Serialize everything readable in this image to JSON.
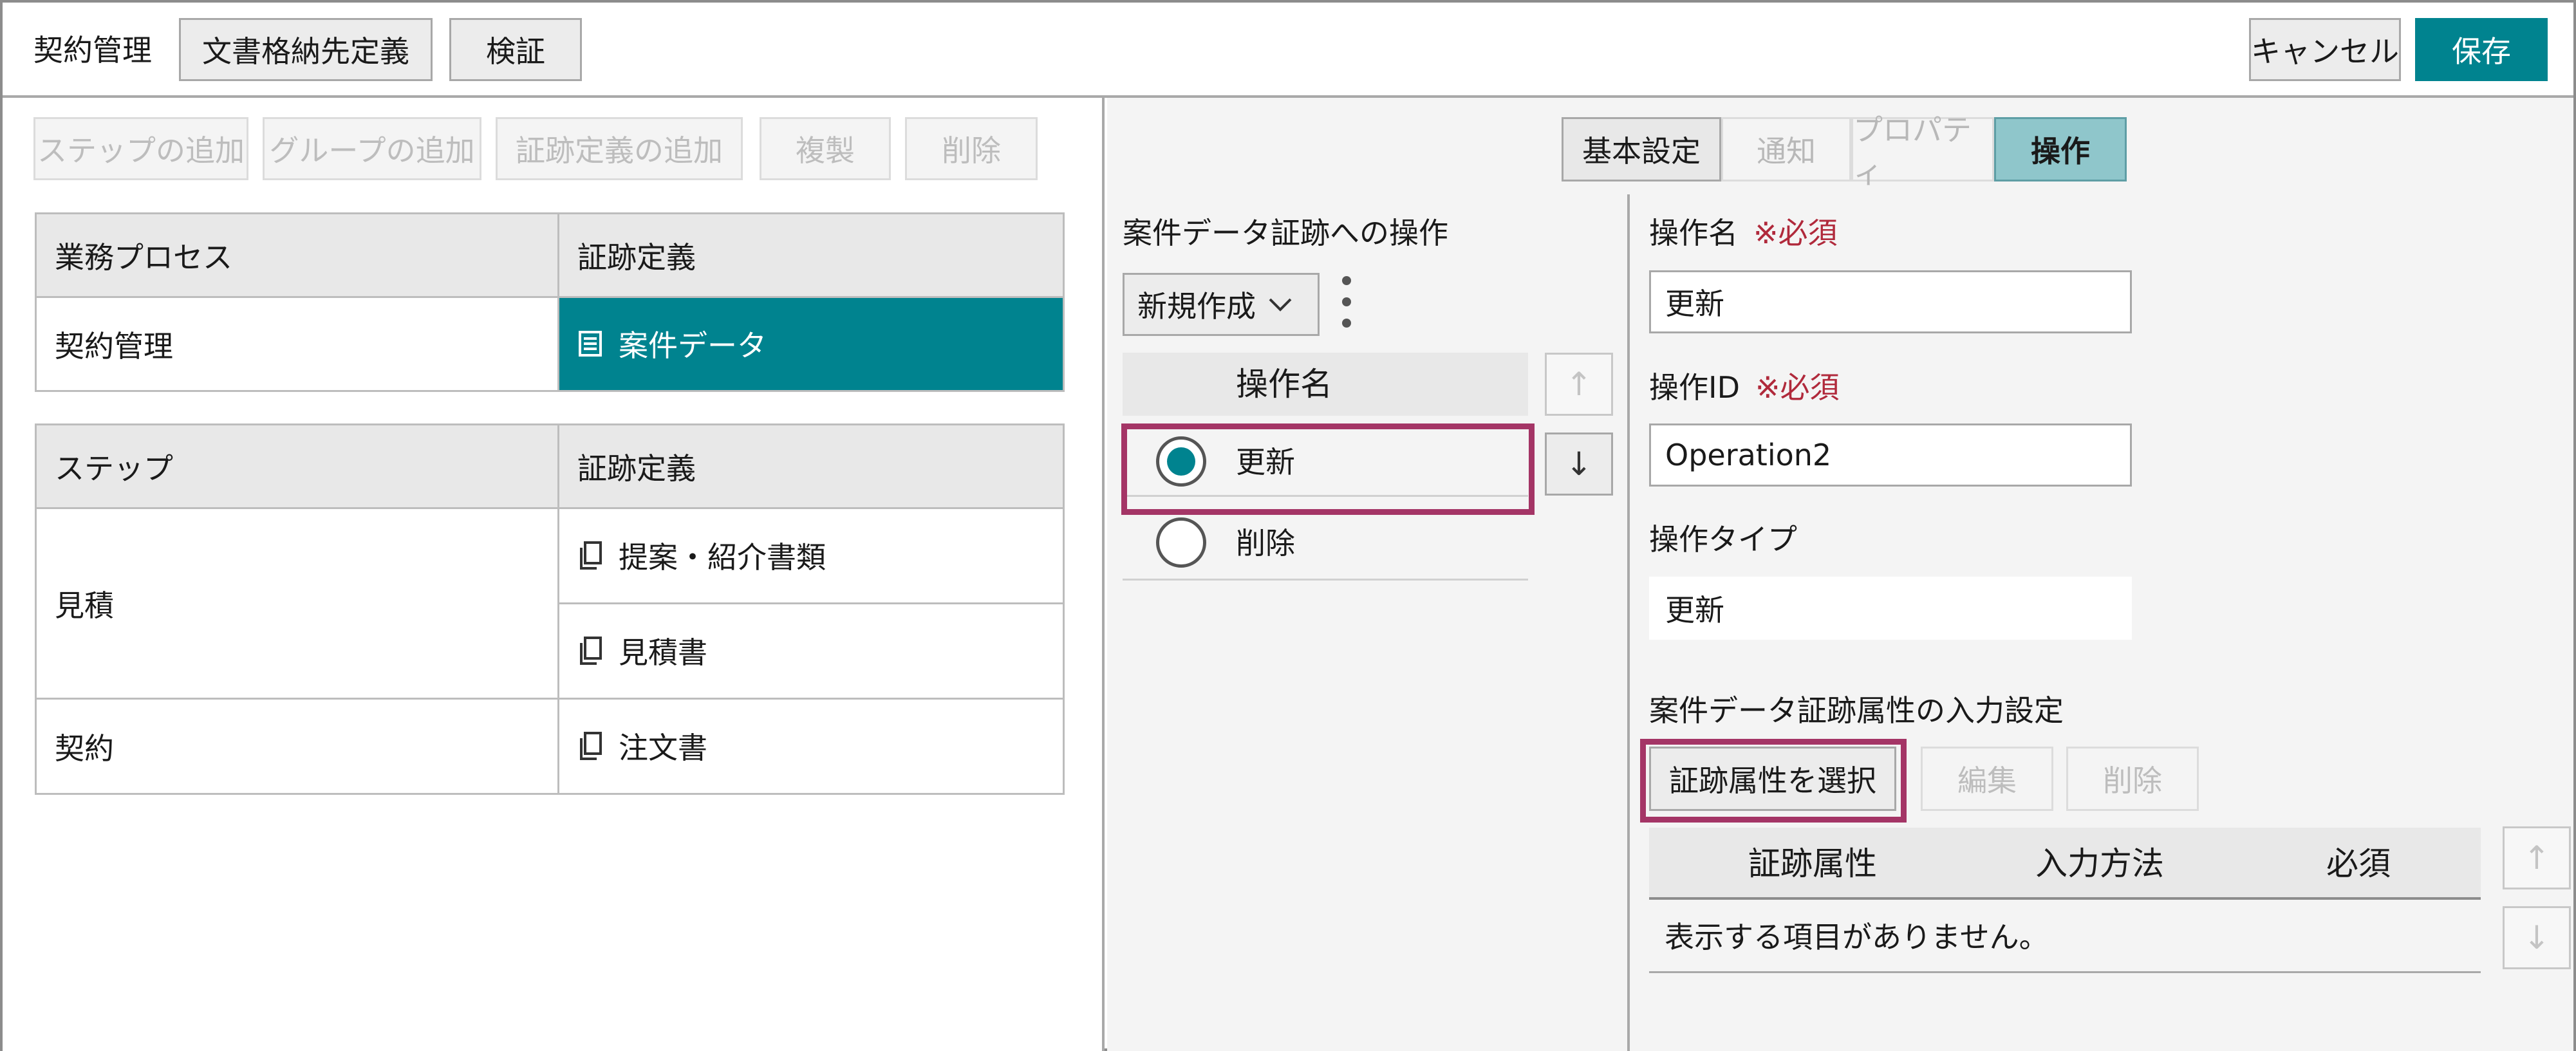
{
  "header": {
    "title": "契約管理",
    "doc_storage_button": "文書格納先定義",
    "verify_button": "検証",
    "cancel_button": "キャンセル",
    "save_button": "保存"
  },
  "left_toolbar": {
    "add_step": "ステップの追加",
    "add_group": "グループの追加",
    "add_evidence_def": "証跡定義の追加",
    "duplicate": "複製",
    "delete": "削除"
  },
  "process_table": {
    "headers": [
      "業務プロセス",
      "証跡定義"
    ],
    "row": {
      "process": "契約管理",
      "evidence": "案件データ",
      "icon": "list-document-icon"
    }
  },
  "step_table": {
    "headers": [
      "ステップ",
      "証跡定義"
    ],
    "rows": [
      {
        "step": "見積",
        "evidence": "提案・紹介書類",
        "icon": "document-copy-icon"
      },
      {
        "step": "",
        "evidence": "見積書",
        "icon": "document-copy-icon"
      },
      {
        "step": "契約",
        "evidence": "注文書",
        "icon": "document-copy-icon"
      }
    ]
  },
  "tabs": [
    {
      "label": "基本設定",
      "state": "normal"
    },
    {
      "label": "通知",
      "state": "disabled"
    },
    {
      "label": "プロパティ",
      "state": "disabled"
    },
    {
      "label": "操作",
      "state": "active"
    }
  ],
  "operations": {
    "section_title": "案件データ証跡への操作",
    "new_dropdown": "新規作成",
    "column_header": "操作名",
    "items": [
      {
        "label": "更新",
        "selected": true
      },
      {
        "label": "削除",
        "selected": false
      }
    ]
  },
  "detail": {
    "op_name_label": "操作名",
    "required_mark": "※必須",
    "op_name_value": "更新",
    "op_id_label": "操作ID",
    "op_id_value": "Operation2",
    "op_type_label": "操作タイプ",
    "op_type_value": "更新",
    "attr_section_title": "案件データ証跡属性の入力設定",
    "select_attr_button": "証跡属性を選択",
    "edit_button": "編集",
    "delete_button": "削除",
    "attr_headers": [
      "証跡属性",
      "入力方法",
      "必須"
    ],
    "empty_message": "表示する項目がありません。"
  },
  "colors": {
    "accent": "#00838f",
    "highlight": "#a43566",
    "required": "#b0293b"
  }
}
